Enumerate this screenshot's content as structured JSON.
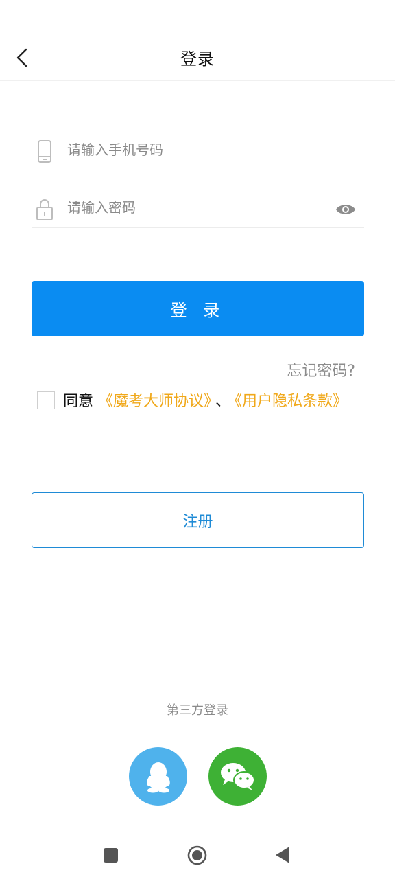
{
  "header": {
    "title": "登录"
  },
  "form": {
    "phone_placeholder": "请输入手机号码",
    "password_placeholder": "请输入密码",
    "login_label": "登 录",
    "forgot_label": "忘记密码?",
    "agree": {
      "prefix": "同意",
      "link1": "《魔考大师协议》",
      "separator": "、",
      "link2": "《用户隐私条款》",
      "checked": false
    },
    "register_label": "注册"
  },
  "third_party": {
    "title": "第三方登录",
    "providers": [
      {
        "name": "qq",
        "icon": "qq-icon",
        "color": "#4fb2ec"
      },
      {
        "name": "wechat",
        "icon": "wechat-icon",
        "color": "#3eb135"
      }
    ]
  },
  "colors": {
    "primary": "#0a8cf2",
    "link": "#f0a81a",
    "register_border": "#1f8bd6"
  }
}
